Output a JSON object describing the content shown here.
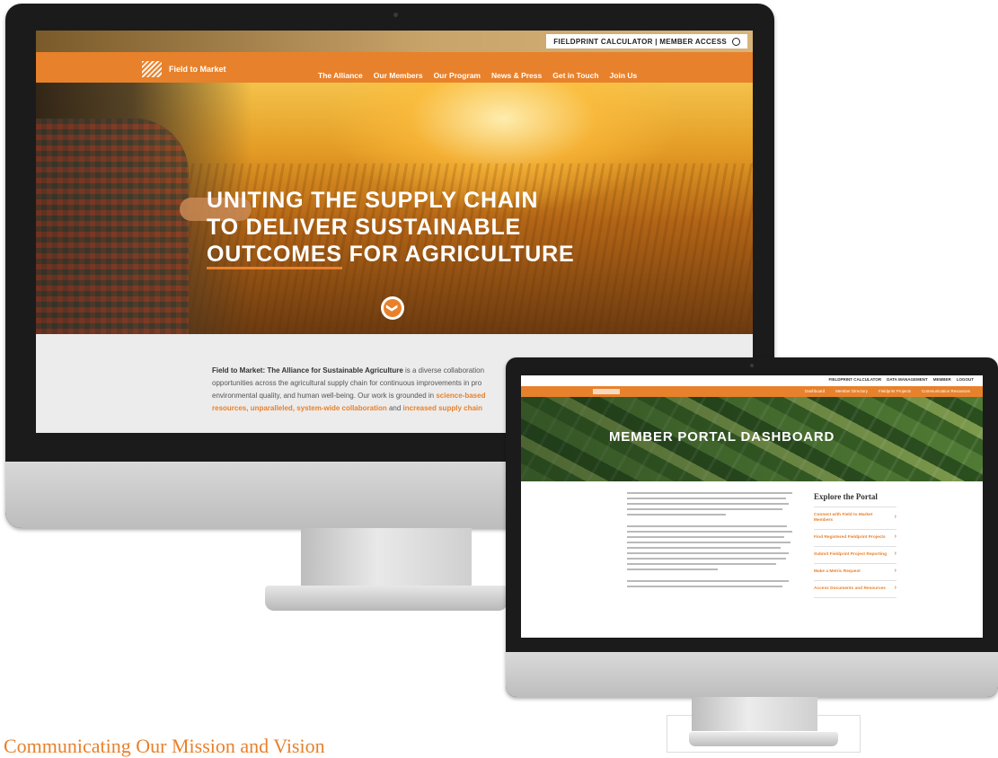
{
  "site1": {
    "util_bar": "FIELDPRINT CALCULATOR | MEMBER ACCESS",
    "logo_text": "Field to Market",
    "nav": [
      "The Alliance",
      "Our Members",
      "Our Program",
      "News & Press",
      "Get in Touch",
      "Join Us"
    ],
    "headline": {
      "line1": "UNITING THE SUPPLY CHAIN",
      "line2": "TO DELIVER SUSTAINABLE",
      "line3_ul": "OUTCOMES",
      "line3_rest": " FOR AGRICULTURE"
    },
    "down_arrow": "❯",
    "body": {
      "lead": "Field to Market: The Alliance for Sustainable Agriculture",
      "l1_rest": " is a diverse collaboration",
      "l2": "opportunities across the agricultural supply chain for continuous improvements in pro",
      "l3": "environmental quality, and human well-being. Our work is grounded in ",
      "l3_or": "science-based",
      "l4_or1": "resources, unparalleled, system-wide collaboration",
      "l4_mid": " and ",
      "l4_or2": "increased supply chain"
    }
  },
  "site2": {
    "util_links": [
      "FIELDPRINT CALCULATOR",
      "DATA MANAGEMENT",
      "MEMBER",
      "LOGOUT"
    ],
    "nav": [
      "Dashboard",
      "Member Directory",
      "Fieldprint Projects",
      "Communication Resources"
    ],
    "title": "MEMBER PORTAL DASHBOARD",
    "sidebar": {
      "title": "Explore the Portal",
      "items": [
        "Connect with Field to Market Members",
        "Find Registered Fieldprint Projects",
        "Submit Fieldprint Project Reporting",
        "Make a Metric Request",
        "Access Documents and Resources"
      ]
    }
  },
  "caption": "Communicating Our Mission and Vision"
}
